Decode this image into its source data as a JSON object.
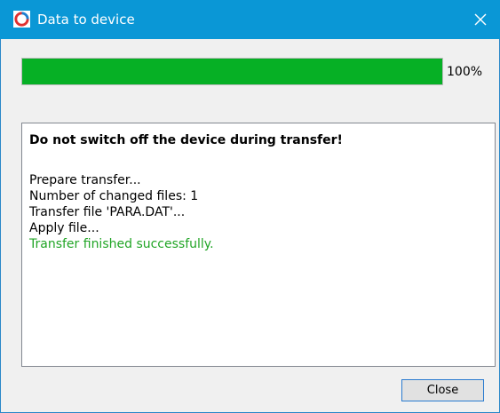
{
  "window": {
    "title": "Data to device",
    "close_icon": "close-icon",
    "app_icon": "app-logo-icon"
  },
  "progress": {
    "percent_label": "100%",
    "value": 1.0,
    "fill_color": "#06b025"
  },
  "log": {
    "warning": "Do not switch off the device during transfer!",
    "lines": [
      {
        "text": "Prepare transfer...",
        "status": "normal"
      },
      {
        "text": "Number of changed files: 1",
        "status": "normal"
      },
      {
        "text": "Transfer file 'PARA.DAT'...",
        "status": "normal"
      },
      {
        "text": "Apply file...",
        "status": "normal"
      },
      {
        "text": "Transfer finished successfully.",
        "status": "success"
      }
    ],
    "success_color": "#21a526"
  },
  "buttons": {
    "close_label": "Close"
  },
  "colors": {
    "titlebar": "#0a97d6",
    "accent_border": "#2a87c8"
  }
}
